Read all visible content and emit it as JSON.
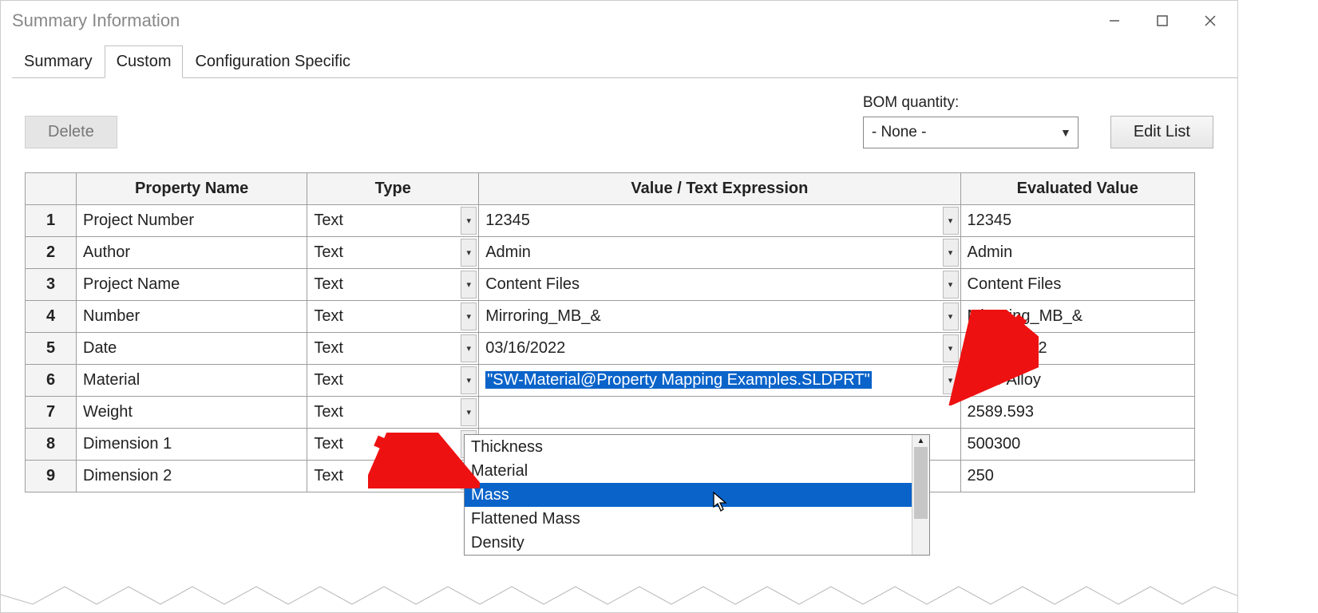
{
  "window": {
    "title": "Summary Information"
  },
  "tabs": {
    "summary": "Summary",
    "custom": "Custom",
    "config": "Configuration Specific",
    "active": "custom"
  },
  "toolbar": {
    "delete_label": "Delete",
    "edit_list_label": "Edit List"
  },
  "bom": {
    "label": "BOM quantity:",
    "selected": "- None -"
  },
  "headers": {
    "rownum": "",
    "name": "Property Name",
    "type": "Type",
    "value": "Value / Text Expression",
    "eval": "Evaluated Value"
  },
  "rows": [
    {
      "n": "1",
      "name": "Project Number",
      "type": "Text",
      "value": "12345",
      "eval": "12345"
    },
    {
      "n": "2",
      "name": "Author",
      "type": "Text",
      "value": "Admin",
      "eval": "Admin"
    },
    {
      "n": "3",
      "name": "Project Name",
      "type": "Text",
      "value": "Content Files",
      "eval": "Content Files"
    },
    {
      "n": "4",
      "name": "Number",
      "type": "Text",
      "value": "Mirroring_MB_&",
      "eval": "Mirroring_MB_&"
    },
    {
      "n": "5",
      "name": "Date",
      "type": "Text",
      "value": "03/16/2022",
      "eval": "03/16/2022"
    },
    {
      "n": "6",
      "name": "Material",
      "type": "Text",
      "value": "\"SW-Material@Property Mapping Examples.SLDPRT\"",
      "eval": "1060 Alloy"
    },
    {
      "n": "7",
      "name": "Weight",
      "type": "Text",
      "value": "",
      "eval": "2589.593"
    },
    {
      "n": "8",
      "name": "Dimension 1",
      "type": "Text",
      "value": "",
      "eval": "500300"
    },
    {
      "n": "9",
      "name": "Dimension 2",
      "type": "Text",
      "value": "",
      "eval": "250"
    }
  ],
  "dropdown": {
    "items": [
      "Thickness",
      "Material",
      "Mass",
      "Flattened Mass",
      "Density"
    ],
    "selected": "Mass"
  }
}
